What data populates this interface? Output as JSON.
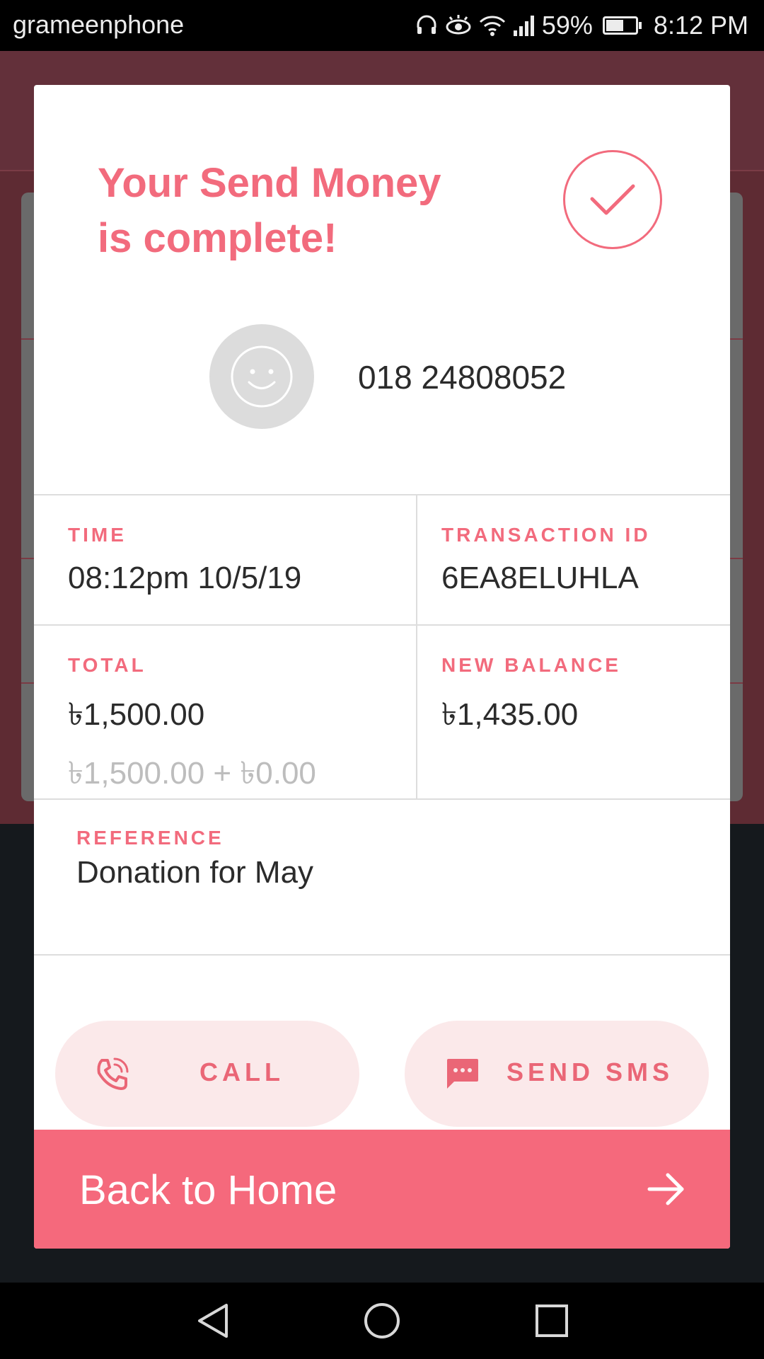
{
  "status_bar": {
    "carrier": "grameenphone",
    "battery_percent": "59%",
    "battery_level": 0.59,
    "time": "8:12 PM",
    "icons": [
      "headset-icon",
      "eye-comfort-icon",
      "wifi-icon",
      "signal-icon",
      "battery-icon"
    ]
  },
  "modal": {
    "headline": {
      "prefix": "Your ",
      "emphasis": "Send Money",
      "suffix": "is complete!"
    },
    "recipient": {
      "avatar_icon": "smiley-icon",
      "number": "018 24808052"
    },
    "details": {
      "time_label": "TIME",
      "time_value": "08:12pm 10/5/19",
      "transaction_label": "TRANSACTION ID",
      "transaction_value": "6EA8ELUHLA",
      "total_label": "TOTAL",
      "total_value": "৳1,500.00",
      "total_breakdown": "৳1,500.00 + ৳0.00",
      "balance_label": "NEW BALANCE",
      "balance_value": "৳1,435.00",
      "reference_label": "REFERENCE",
      "reference_value": "Donation for May"
    },
    "actions": {
      "call_label": "CALL",
      "sms_label": "SEND SMS"
    },
    "home_button": {
      "label": "Back to Home"
    }
  },
  "colors": {
    "accent": "#f26b7d",
    "button": "#f5697c",
    "pill_bg": "#fbe9ea"
  }
}
